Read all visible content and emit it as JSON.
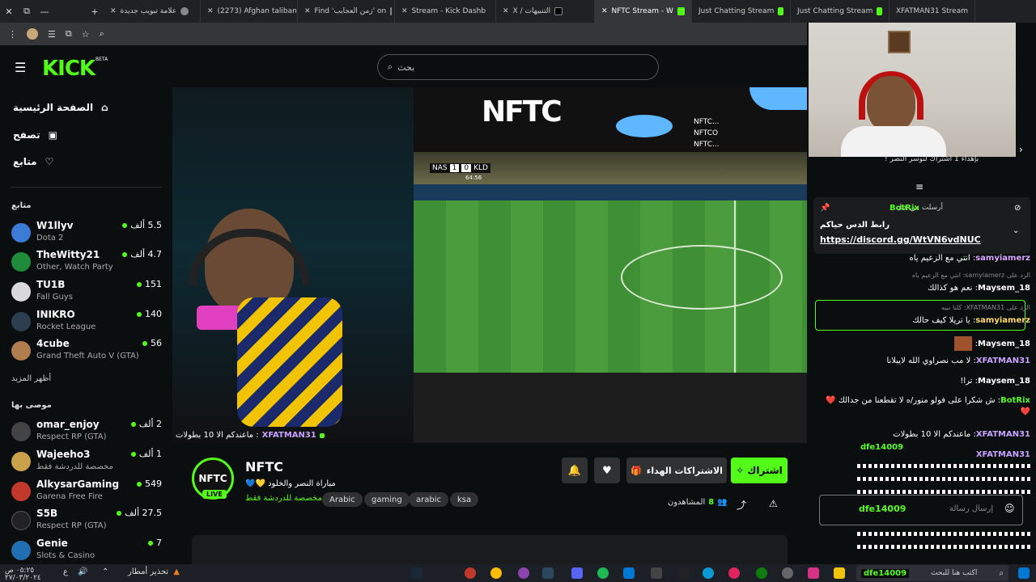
{
  "browser": {
    "tabs": [
      {
        "label": "علامة تبويب جديدة",
        "icon": "globe-icon"
      },
      {
        "label": "(2273) Afghan taliban",
        "icon": "youtube-icon"
      },
      {
        "label": "Find 'زمن العجايب' on",
        "icon": "tiktok-icon"
      },
      {
        "label": "Stream - Kick Dashb",
        "icon": "kick-icon"
      },
      {
        "label": "X / التنبيهات",
        "icon": "x-icon"
      },
      {
        "label": "NFTC Stream - W",
        "icon": "kick-icon",
        "active": true
      },
      {
        "label": "Just Chatting Stream",
        "icon": "kick-icon"
      },
      {
        "label": "Just Chatting Stream",
        "icon": "kick-icon"
      },
      {
        "label": "XFATMAN31 Stream",
        "icon": "kick-icon"
      }
    ],
    "new_tab": "+",
    "window_controls": [
      "✕",
      "⧉",
      "—"
    ]
  },
  "header": {
    "logo": "KICK",
    "logo_badge": "BETA",
    "search_placeholder": "بحث"
  },
  "sidebar": {
    "nav": [
      {
        "label": "الصفحة الرئيسية",
        "icon": "home-icon"
      },
      {
        "label": "تصفح",
        "icon": "browse-icon"
      },
      {
        "label": "متابع",
        "icon": "heart-icon"
      }
    ],
    "following_title": "متابع",
    "following": [
      {
        "name": "W1llyv",
        "category": "Dota 2",
        "viewers": "5.5 ألف",
        "color": "#3a7bd5"
      },
      {
        "name": "TheWitty21",
        "category": "Other, Watch Party",
        "viewers": "4.7 ألف",
        "color": "#1e8c3a"
      },
      {
        "name": "TU1B",
        "category": "Fall Guys",
        "viewers": "151",
        "color": "#d9d9d9"
      },
      {
        "name": "INIKRO",
        "category": "Rocket League",
        "viewers": "140",
        "color": "#2c3e50"
      },
      {
        "name": "4cube",
        "category": "Grand Theft Auto V (GTA)",
        "viewers": "56",
        "color": "#b07d4f"
      }
    ],
    "show_more": "أظهر المزيد",
    "recommended_title": "موصى بها",
    "recommended": [
      {
        "name": "omar_enjoy",
        "category": "Respect RP (GTA)",
        "viewers": "2 ألف",
        "color": "#444"
      },
      {
        "name": "Wajeeho3",
        "category": "مخصصة للدردشة فقط",
        "viewers": "1 ألف",
        "color": "#c9a24a"
      },
      {
        "name": "AlkysarGaming",
        "category": "Garena Free Fire",
        "viewers": "549",
        "color": "#c0392b"
      },
      {
        "name": "S5B",
        "category": "Respect RP (GTA)",
        "viewers": "27.5 ألف",
        "color": "#222"
      },
      {
        "name": "Genie",
        "category": "Slots & Casino",
        "viewers": "7",
        "color": "#1f6fb2"
      }
    ]
  },
  "video": {
    "overlay_user": "XFATMAN31",
    "overlay_msg": ": ماعندكم الا 10 بطولات",
    "score_home": "NAS",
    "score_home_goals": "1",
    "score_away_goals": "0",
    "score_away": "KLD",
    "match_time": "64:56",
    "brand": "NFTC",
    "socials": [
      "NFTC...",
      "NFTCO",
      "NFTC..."
    ]
  },
  "channel": {
    "name": "NFTC",
    "live_badge": "LIVE",
    "title": "مباراة النصر والخلود 💛💙",
    "category": "مخصصة للدردشة فقط",
    "tags": [
      "Arabic",
      "gaming",
      "arabic",
      "ksa"
    ],
    "subscribe_label": "اشتراك",
    "gift_label": "الاشتراكات الهداء",
    "viewers_label": "المشاهدون",
    "viewers_count": "8"
  },
  "chat": {
    "top_banner": "بإهداء 1 اشتراك لنوسر النصر !",
    "pinned": {
      "pinned_by": "أرسلت من قبل",
      "user": "BotRix",
      "title": "رابط الدس حياكم",
      "link": "https://discord.gg/WtVN6vdNUC"
    },
    "messages": [
      {
        "user": "samyiamerz",
        "text": "انتي مع الزعيم ياه",
        "color": "#d8a5ff"
      },
      {
        "reply": "الرد على samyiamerz: انتي مع الزعيم ياه"
      },
      {
        "user": "Maysem_18",
        "text": "نعم هو كذالك",
        "color": "#fff"
      },
      {
        "reply": "الرد على XFATMAN31: كلنا نبيه"
      },
      {
        "user": "samyiamerz",
        "text": "يا تريلا كيف حالك",
        "color": "#ffd866"
      },
      {
        "user": "Maysem_18",
        "text": "",
        "color": "#fff"
      },
      {
        "user": "XFATMAN31",
        "text": "لا مب نصراوي الله لايبلانا",
        "color": "#c7a3ff"
      },
      {
        "user": "Maysem_18",
        "text": "ترا!",
        "color": "#fff"
      },
      {
        "user": "BotRix",
        "text": "ش شكرا على فولو منور/ه لا تقطعنا من جدالك ❤️❤️",
        "color": "#53fc18"
      },
      {
        "user": "XFATMAN31",
        "text": "ماعندكم الا 10 بطولات",
        "color": "#c7a3ff"
      },
      {
        "user": "XFATMAN31",
        "text": "",
        "color": "#c7a3ff"
      },
      {
        "user": "dfe14009",
        "text": ":",
        "color": "#53fc18"
      }
    ],
    "input_user": "dfe14009",
    "input_placeholder": "إرسال رسالة"
  },
  "taskbar": {
    "search_placeholder": "اكتب هنا للبحث",
    "search_user": "dfe14009",
    "weather": "تحذير أمطار",
    "time": "٠٥:٢٥ ص",
    "date": "٢٧/٠٣/٢٠٢٤",
    "lang": "ع"
  }
}
